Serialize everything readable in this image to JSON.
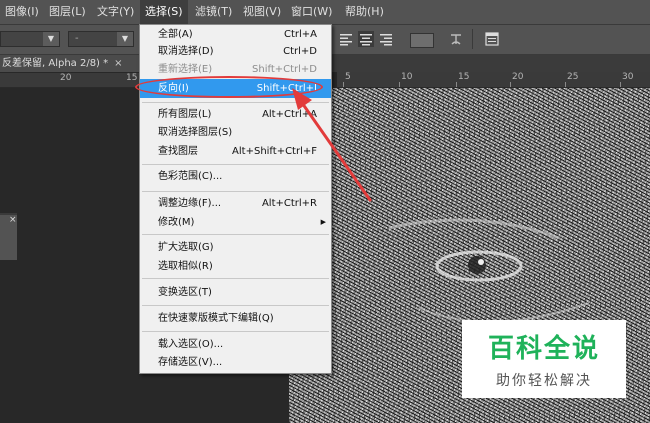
{
  "menubar": {
    "items": [
      {
        "label": "图像(I)"
      },
      {
        "label": "图层(L)"
      },
      {
        "label": "文字(Y)"
      },
      {
        "label": "选择(S)"
      },
      {
        "label": "滤镜(T)"
      },
      {
        "label": "视图(V)"
      },
      {
        "label": "窗口(W)"
      },
      {
        "label": "帮助(H)"
      }
    ]
  },
  "options_bar": {
    "select2_value": "-"
  },
  "document": {
    "tab_title": "反差保留, Alpha 2/8) *",
    "tab_close": "×"
  },
  "ruler": {
    "left_labels": [
      "20",
      "15"
    ],
    "right_labels": [
      "5",
      "10",
      "15",
      "20",
      "25",
      "30"
    ]
  },
  "panel": {
    "close": "×"
  },
  "select_menu": {
    "items": [
      {
        "label": "全部(A)",
        "shortcut": "Ctrl+A"
      },
      {
        "label": "取消选择(D)",
        "shortcut": "Ctrl+D"
      },
      {
        "label": "重新选择(E)",
        "shortcut": "Shift+Ctrl+D"
      },
      {
        "label": "反向(I)",
        "shortcut": "Shift+Ctrl+I"
      },
      {
        "label": "所有图层(L)",
        "shortcut": "Alt+Ctrl+A"
      },
      {
        "label": "取消选择图层(S)",
        "shortcut": ""
      },
      {
        "label": "查找图层",
        "shortcut": "Alt+Shift+Ctrl+F"
      },
      {
        "label": "色彩范围(C)...",
        "shortcut": ""
      },
      {
        "label": "调整边缘(F)...",
        "shortcut": "Alt+Ctrl+R"
      },
      {
        "label": "修改(M)",
        "shortcut": ""
      },
      {
        "label": "扩大选取(G)",
        "shortcut": ""
      },
      {
        "label": "选取相似(R)",
        "shortcut": ""
      },
      {
        "label": "变换选区(T)",
        "shortcut": ""
      },
      {
        "label": "在快速蒙版模式下编辑(Q)",
        "shortcut": ""
      },
      {
        "label": "载入选区(O)...",
        "shortcut": ""
      },
      {
        "label": "存储选区(V)...",
        "shortcut": ""
      }
    ]
  },
  "watermark": {
    "title": "百科全说",
    "subtitle": "助你轻松解决"
  },
  "colors": {
    "highlight": "#3199ee",
    "annotation": "#e23b3b",
    "watermark_green": "#1fb25a"
  }
}
